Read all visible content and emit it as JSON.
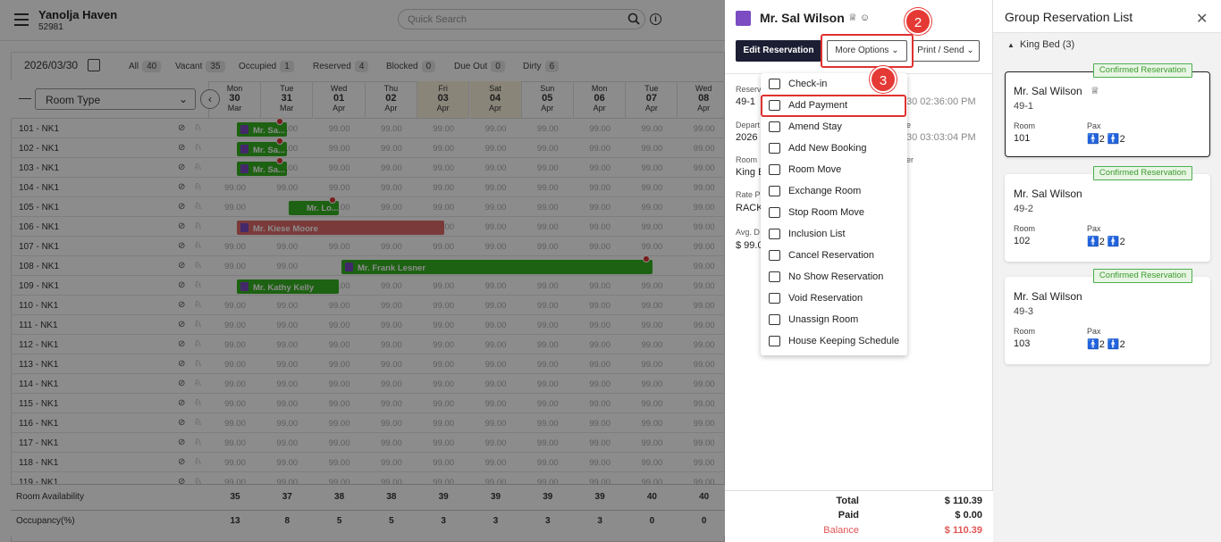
{
  "header": {
    "hotel_name": "Yanolja Haven",
    "hotel_code": "52981",
    "search_placeholder": "Quick Search",
    "info_label": "i"
  },
  "filters": {
    "date": "2026/03/30",
    "items": [
      {
        "label": "All",
        "count": "40"
      },
      {
        "label": "Vacant",
        "count": "35"
      },
      {
        "label": "Occupied",
        "count": "1"
      },
      {
        "label": "Reserved",
        "count": "4"
      },
      {
        "label": "Blocked",
        "count": "0"
      },
      {
        "label": "Due Out",
        "count": "0"
      },
      {
        "label": "Dirty",
        "count": "6"
      }
    ]
  },
  "grid": {
    "room_type_label": "Room Type",
    "dates": [
      {
        "dow": "Mon",
        "day": "30",
        "mon": "Mar"
      },
      {
        "dow": "Tue",
        "day": "31",
        "mon": "Mar"
      },
      {
        "dow": "Wed",
        "day": "01",
        "mon": "Apr"
      },
      {
        "dow": "Thu",
        "day": "02",
        "mon": "Apr"
      },
      {
        "dow": "Fri",
        "day": "03",
        "mon": "Apr"
      },
      {
        "dow": "Sat",
        "day": "04",
        "mon": "Apr"
      },
      {
        "dow": "Sun",
        "day": "05",
        "mon": "Apr"
      },
      {
        "dow": "Mon",
        "day": "06",
        "mon": "Apr"
      },
      {
        "dow": "Tue",
        "day": "07",
        "mon": "Apr"
      },
      {
        "dow": "Wed",
        "day": "08",
        "mon": "Apr"
      }
    ],
    "rooms": [
      "101 - NK1",
      "102 - NK1",
      "103 - NK1",
      "104 - NK1",
      "105 - NK1",
      "106 - NK1",
      "107 - NK1",
      "108 - NK1",
      "109 - NK1",
      "110 - NK1",
      "111 - NK1",
      "112 - NK1",
      "113 - NK1",
      "114 - NK1",
      "115 - NK1",
      "116 - NK1",
      "117 - NK1",
      "118 - NK1",
      "119 - NK1"
    ],
    "rate": "99.00",
    "bookings": {
      "r101": "Mr. Sa...",
      "r102": "Mr. Sa...",
      "r103": "Mr. Sa...",
      "r105": "Mr. Lo...",
      "r106": "Mr. Kiese Moore",
      "r108": "Mr. Frank Lesner",
      "r109": "Mr. Kathy Kelly"
    },
    "availability_label": "Room Availability",
    "availability": [
      "35",
      "37",
      "38",
      "38",
      "39",
      "39",
      "39",
      "39",
      "40",
      "40"
    ],
    "occupancy_label": "Occupancy(%)",
    "occupancy": [
      "13",
      "8",
      "5",
      "5",
      "3",
      "3",
      "3",
      "3",
      "0",
      "0"
    ]
  },
  "panel": {
    "guest_name": "Mr. Sal Wilson",
    "edit_label": "Edit Reservation",
    "more_label": "More Options",
    "print_label": "Print / Send",
    "step2": "2",
    "step3": "3",
    "fields": {
      "res_label": "Reserv",
      "res_val": "49-1",
      "arr_time": "30 02:36:00 PM",
      "dep_label": "Depart",
      "dep_val": "2026",
      "dep_label2": "e",
      "dep_time": "30 03:03:04 PM",
      "room_label": "Room",
      "room_val": "King B",
      "room_label2": "er",
      "rate_label": "Rate Pl",
      "rate_val": "RACK",
      "avg_label": "Avg. D",
      "avg_val": "$ 99.0"
    },
    "menu": [
      "Check-in",
      "Add Payment",
      "Amend Stay",
      "Add New Booking",
      "Room Move",
      "Exchange Room",
      "Stop Room Move",
      "Inclusion List",
      "Cancel Reservation",
      "No Show Reservation",
      "Void Reservation",
      "Unassign Room",
      "House Keeping Schedule"
    ],
    "totals": {
      "total_label": "Total",
      "total_val": "$ 110.39",
      "paid_label": "Paid",
      "paid_val": "$ 0.00",
      "balance_label": "Balance",
      "balance_val": "$ 110.39"
    }
  },
  "group": {
    "title": "Group Reservation List",
    "category": "King Bed (3)",
    "badge": "Confirmed Reservation",
    "room_label": "Room",
    "pax_label": "Pax",
    "cards": [
      {
        "name": "Mr. Sal Wilson",
        "code": "49-1",
        "room": "101",
        "adults": "2",
        "children": "2"
      },
      {
        "name": "Mr. Sal Wilson",
        "code": "49-2",
        "room": "102",
        "adults": "2",
        "children": "2"
      },
      {
        "name": "Mr. Sal Wilson",
        "code": "49-3",
        "room": "103",
        "adults": "2",
        "children": "2"
      }
    ]
  },
  "colors": {
    "green": "#36b322",
    "red": "#e06b6b",
    "purple": "#7b4cc2",
    "accent": "#1c1f33",
    "highlight": "#e03030"
  }
}
